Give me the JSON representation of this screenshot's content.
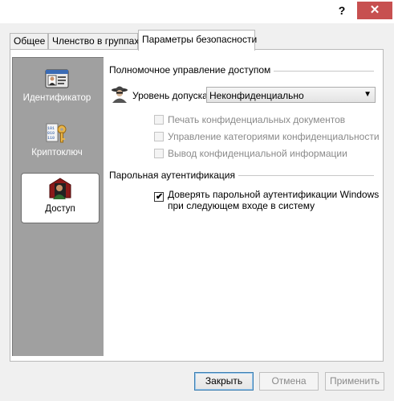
{
  "titlebar": {
    "help_label": "?",
    "close_label": "✕"
  },
  "tabs": [
    {
      "label": "Общее",
      "active": false
    },
    {
      "label": "Членство в группах",
      "active": false
    },
    {
      "label": "Параметры безопасности",
      "active": true
    }
  ],
  "nav": {
    "items": [
      {
        "label": "Идентификатор",
        "icon": "id-card-icon",
        "selected": false
      },
      {
        "label": "Криптоключ",
        "icon": "crypto-key-icon",
        "selected": false
      },
      {
        "label": "Доступ",
        "icon": "access-user-icon",
        "selected": true
      }
    ]
  },
  "access_group": {
    "title": "Полномочное управление доступом",
    "level_label": "Уровень допуска:",
    "level_value": "Неконфиденциально",
    "checkboxes": [
      {
        "label": "Печать конфиденциальных документов",
        "checked": false,
        "enabled": false
      },
      {
        "label": "Управление категориями конфиденциальности",
        "checked": false,
        "enabled": false
      },
      {
        "label": "Вывод конфиденциальной информации",
        "checked": false,
        "enabled": false
      }
    ]
  },
  "password_group": {
    "title": "Парольная аутентификация",
    "trust_line1": "Доверять парольной аутентификации Windows",
    "trust_line2": "при следующем входе в систему",
    "trust_checked": true
  },
  "buttons": {
    "close": "Закрыть",
    "cancel": "Отмена",
    "apply": "Применить"
  }
}
